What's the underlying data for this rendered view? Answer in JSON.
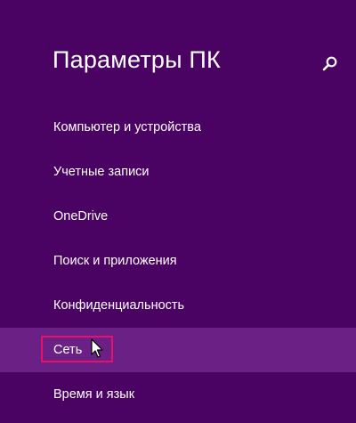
{
  "window": {
    "title": "Параметры ПК"
  },
  "colors": {
    "background": "#4b0363",
    "selected_background": "#6b2086",
    "highlight_border": "#e8106a",
    "text": "#ffffff"
  },
  "search": {
    "icon": "search-icon"
  },
  "nav": {
    "items": [
      {
        "label": "Компьютер и устройства"
      },
      {
        "label": "Учетные записи"
      },
      {
        "label": "OneDrive"
      },
      {
        "label": "Поиск и приложения"
      },
      {
        "label": "Конфиденциальность"
      },
      {
        "label": "Сеть"
      },
      {
        "label": "Время и язык"
      }
    ],
    "selected_index": 5
  }
}
